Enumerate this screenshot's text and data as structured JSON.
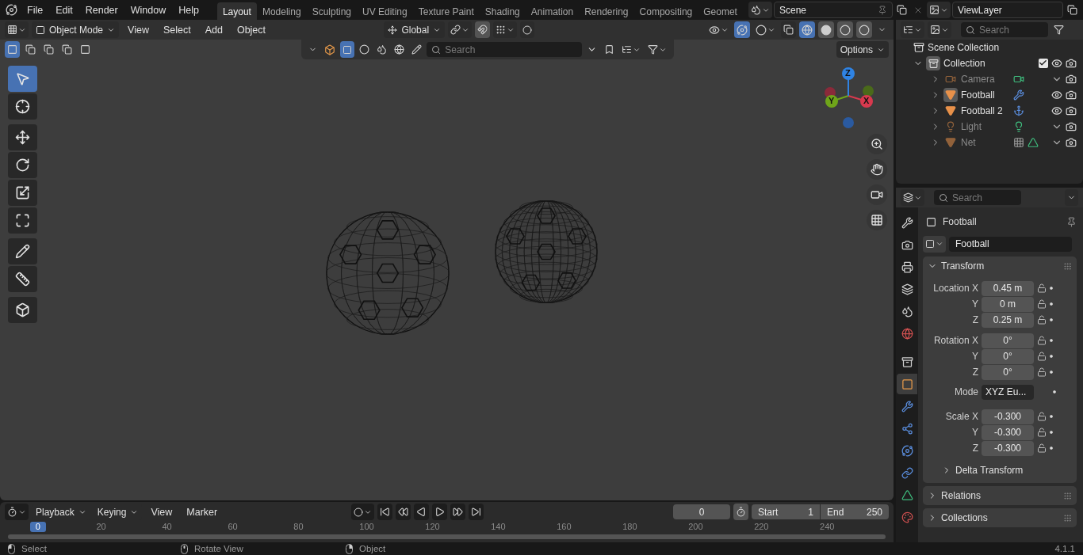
{
  "menu": [
    "File",
    "Edit",
    "Render",
    "Window",
    "Help"
  ],
  "workspaces": [
    {
      "label": "Layout",
      "selected": true
    },
    {
      "label": "Modeling",
      "selected": false
    },
    {
      "label": "Sculpting",
      "selected": false
    },
    {
      "label": "UV Editing",
      "selected": false
    },
    {
      "label": "Texture Paint",
      "selected": false
    },
    {
      "label": "Shading",
      "selected": false
    },
    {
      "label": "Animation",
      "selected": false
    },
    {
      "label": "Rendering",
      "selected": false
    },
    {
      "label": "Compositing",
      "selected": false
    },
    {
      "label": "Geomet",
      "selected": false
    }
  ],
  "scene": {
    "value": "Scene"
  },
  "view_layer": {
    "value": "ViewLayer"
  },
  "viewport": {
    "mode": "Object Mode",
    "menus": [
      "View",
      "Select",
      "Add",
      "Object"
    ],
    "orientation": "Global",
    "search": {
      "placeholder": "Search"
    },
    "options": "Options",
    "tool_groups": [
      [
        {
          "kind": "select-box",
          "selected": true
        },
        {
          "kind": "cursor",
          "selected": false
        }
      ],
      [
        {
          "kind": "move",
          "selected": false
        },
        {
          "kind": "rotate",
          "selected": false
        },
        {
          "kind": "scale",
          "selected": false
        },
        {
          "kind": "transform",
          "selected": false
        }
      ],
      [
        {
          "kind": "annotate",
          "selected": false
        },
        {
          "kind": "measure",
          "selected": false
        }
      ],
      [
        {
          "kind": "add-cube",
          "selected": false
        }
      ]
    ],
    "gizmo": [
      {
        "label": "X",
        "color": "#d8394e"
      },
      {
        "label": "Y",
        "color": "#6fa51a"
      },
      {
        "label": "Z",
        "color": "#2f83e3"
      }
    ]
  },
  "outliner": {
    "search": {
      "placeholder": "Search"
    },
    "root": "Scene Collection",
    "items": [
      {
        "name": "Collection",
        "kind": "collection",
        "expanded": true,
        "checked": true,
        "visible": true,
        "active": true,
        "children": [
          {
            "name": "Camera",
            "kind": "camera",
            "visible": false,
            "active": false,
            "extras": [
              {
                "kind": "camera-data"
              }
            ]
          },
          {
            "name": "Football",
            "kind": "mesh",
            "visible": true,
            "active": true,
            "extras": [
              {
                "kind": "modifier"
              }
            ]
          },
          {
            "name": "Football 2",
            "kind": "mesh",
            "visible": true,
            "active": false,
            "extras": [
              {
                "kind": "hook"
              }
            ]
          },
          {
            "name": "Light",
            "kind": "light",
            "visible": false,
            "active": false,
            "extras": [
              {
                "kind": "light-data"
              }
            ]
          },
          {
            "name": "Net",
            "kind": "mesh",
            "visible": false,
            "active": false,
            "extras": [
              {
                "kind": "particles"
              },
              {
                "kind": "mesh-data"
              }
            ]
          }
        ]
      }
    ]
  },
  "properties": {
    "search": {
      "placeholder": "Search"
    },
    "tab_groups": [
      [
        {
          "kind": "tool",
          "selected": false
        },
        {
          "kind": "render",
          "selected": false
        },
        {
          "kind": "output",
          "selected": false
        },
        {
          "kind": "view-layer",
          "selected": false
        },
        {
          "kind": "scene",
          "selected": false
        },
        {
          "kind": "world",
          "selected": false
        }
      ],
      [
        {
          "kind": "collection",
          "selected": false
        },
        {
          "kind": "object",
          "selected": true
        },
        {
          "kind": "modifiers",
          "selected": false
        },
        {
          "kind": "particles",
          "selected": false
        },
        {
          "kind": "physics",
          "selected": false
        },
        {
          "kind": "constraints",
          "selected": false
        },
        {
          "kind": "data",
          "selected": false
        },
        {
          "kind": "material",
          "selected": false
        }
      ]
    ],
    "object": "Football",
    "datablock": "Football",
    "transform": {
      "title": "Transform",
      "expanded": true,
      "groups": [
        [
          {
            "label": "Location X",
            "value": "0.45 m",
            "kind": "number"
          },
          {
            "label": "Y",
            "value": "0 m",
            "kind": "number"
          },
          {
            "label": "Z",
            "value": "0.25 m",
            "kind": "number"
          }
        ],
        [
          {
            "label": "Rotation X",
            "value": "0°",
            "kind": "number"
          },
          {
            "label": "Y",
            "value": "0°",
            "kind": "number"
          },
          {
            "label": "Z",
            "value": "0°",
            "kind": "number"
          },
          {
            "label": "Mode",
            "value": "XYZ Eu...",
            "kind": "dropdown"
          }
        ],
        [
          {
            "label": "Scale X",
            "value": "-0.300",
            "kind": "number"
          },
          {
            "label": "Y",
            "value": "-0.300",
            "kind": "number"
          },
          {
            "label": "Z",
            "value": "-0.300",
            "kind": "number"
          }
        ]
      ],
      "subpanel": {
        "title": "Delta Transform",
        "expanded": false
      }
    },
    "panels": [
      {
        "title": "Relations",
        "expanded": false
      },
      {
        "title": "Collections",
        "expanded": false
      }
    ]
  },
  "timeline": {
    "menus": [
      {
        "label": "Playback",
        "kind": "dropdown"
      },
      {
        "label": "Keying",
        "kind": "dropdown"
      },
      {
        "label": "View",
        "kind": "menu"
      },
      {
        "label": "Marker",
        "kind": "menu"
      }
    ],
    "frame": "0",
    "start": {
      "label": "Start",
      "value": "1"
    },
    "end": {
      "label": "End",
      "value": "250"
    },
    "ruler": [
      {
        "label": "0",
        "selected": true
      },
      {
        "label": "20",
        "selected": false
      },
      {
        "label": "40",
        "selected": false
      },
      {
        "label": "60",
        "selected": false
      },
      {
        "label": "80",
        "selected": false
      },
      {
        "label": "100",
        "selected": false
      },
      {
        "label": "120",
        "selected": false
      },
      {
        "label": "140",
        "selected": false
      },
      {
        "label": "160",
        "selected": false
      },
      {
        "label": "180",
        "selected": false
      },
      {
        "label": "200",
        "selected": false
      },
      {
        "label": "220",
        "selected": false
      },
      {
        "label": "240",
        "selected": false
      }
    ]
  },
  "status_bar": {
    "hints": [
      {
        "label": "Select",
        "kind": "left-mouse"
      },
      {
        "label": "Rotate View",
        "kind": "middle-mouse"
      },
      {
        "label": "Object",
        "kind": "right-mouse"
      }
    ],
    "version": "4.1.1"
  }
}
